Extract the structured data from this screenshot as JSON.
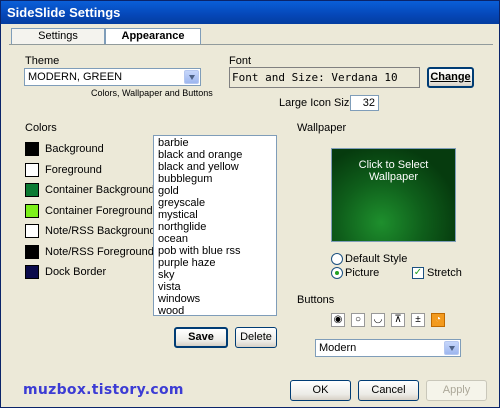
{
  "window": {
    "title": "SideSlide Settings"
  },
  "tabs": [
    {
      "label": "Settings",
      "active": false
    },
    {
      "label": "Appearance",
      "active": true
    }
  ],
  "theme": {
    "label": "Theme",
    "selected": "MODERN, GREEN",
    "hint": "Colors, Wallpaper and Buttons"
  },
  "font": {
    "label": "Font",
    "value": "Font and Size: Verdana 10",
    "change_label": "Change",
    "large_icon_label": "Large Icon Size:",
    "large_icon_value": "32"
  },
  "colors": {
    "label": "Colors",
    "items": [
      {
        "label": "Background",
        "color": "#000000"
      },
      {
        "label": "Foreground",
        "color": "#ffffff"
      },
      {
        "label": "Container Background",
        "color": "#0a7a32"
      },
      {
        "label": "Container Foreground",
        "color": "#7cf01a"
      },
      {
        "label": "Note/RSS Background",
        "color": "#ffffff"
      },
      {
        "label": "Note/RSS Foreground",
        "color": "#000000"
      },
      {
        "label": "Dock Border",
        "color": "#0a0a4a"
      }
    ]
  },
  "theme_list": {
    "items": [
      "barbie",
      "black and orange",
      "black and yellow",
      "bubblegum",
      "gold",
      "greyscale",
      "mystical",
      "northglide",
      "ocean",
      "pob with blue rss",
      "purple haze",
      "sky",
      "vista",
      "windows",
      "wood"
    ],
    "save_label": "Save",
    "delete_label": "Delete"
  },
  "wallpaper": {
    "label": "Wallpaper",
    "preview_text_1": "Click to Select",
    "preview_text_2": "Wallpaper",
    "default_style_label": "Default Style",
    "picture_label": "Picture",
    "stretch_label": "Stretch",
    "picture_selected": true,
    "stretch_checked": true
  },
  "buttons": {
    "label": "Buttons",
    "icons": [
      "circle-dot-icon",
      "circle-ring-icon",
      "circle-open-icon",
      "pin-icon",
      "plus-icon",
      "rss-icon"
    ],
    "style_selected": "Modern"
  },
  "footer": {
    "watermark": "muzbox.tistory.com",
    "ok_label": "OK",
    "cancel_label": "Cancel",
    "apply_label": "Apply"
  }
}
